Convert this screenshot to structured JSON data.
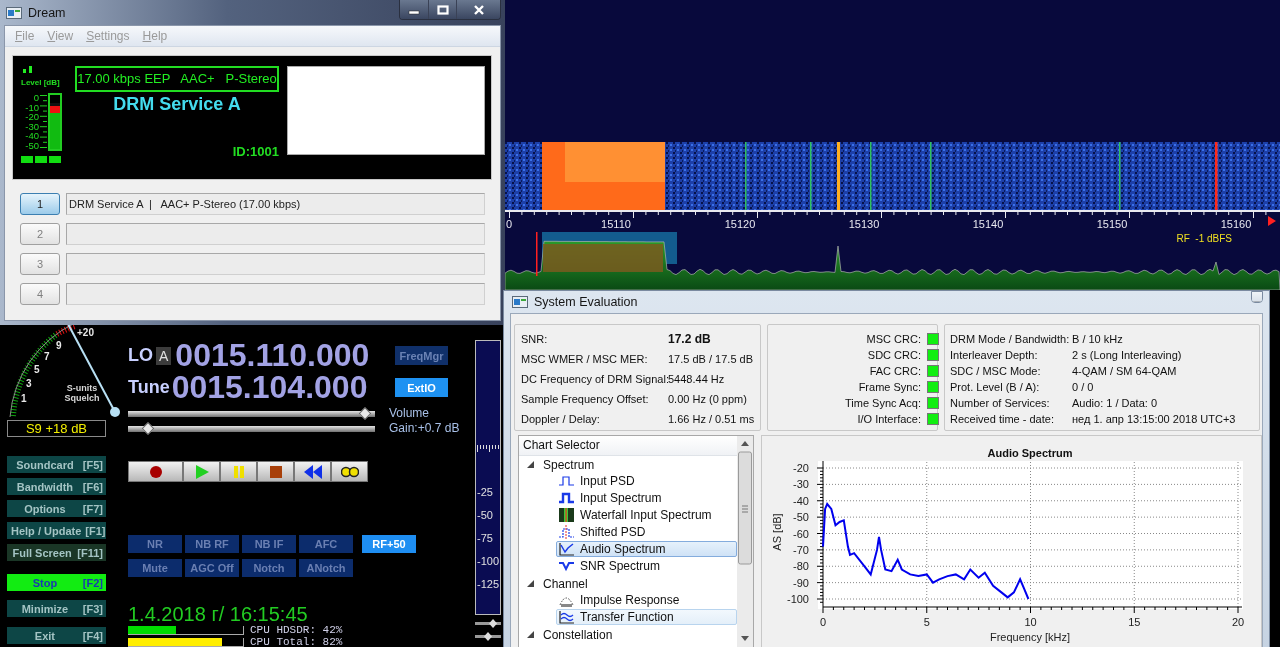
{
  "hdsdr": {
    "frequency_scale": [
      "0",
      "15110",
      "15120",
      "15130",
      "15140",
      "15150",
      "15160"
    ],
    "rf_level": "RF  -1 dBFS",
    "s_meter": {
      "top_mark": "+20",
      "scale": [
        "9",
        "7",
        "5",
        "3",
        "1"
      ],
      "units_label": "S-units",
      "squelch_label": "Squelch",
      "reading": "S9 +18 dB"
    },
    "lo": {
      "label": "LO",
      "vfo": "A",
      "frequency": "0015.110.000"
    },
    "tune": {
      "label": "Tune",
      "frequency": "0015.104.000"
    },
    "side_buttons": [
      {
        "label": "FreqMgr",
        "active": false
      },
      {
        "label": "ExtIO",
        "active": true
      }
    ],
    "sliders": [
      {
        "level": 0.96
      },
      {
        "level": 0.08
      }
    ],
    "volume_label": "Volume",
    "gain": "Gain:+0.7 dB",
    "transport": [
      {
        "kind": "record"
      },
      {
        "kind": "play"
      },
      {
        "kind": "pause"
      },
      {
        "kind": "stop"
      },
      {
        "kind": "rewind"
      },
      {
        "kind": "loop"
      }
    ],
    "function_buttons": [
      {
        "label": "Soundcard",
        "key": "[F5]",
        "active": false
      },
      {
        "label": "Bandwidth",
        "key": "[F6]",
        "active": false
      },
      {
        "label": "Options",
        "key": "[F7]",
        "active": false
      },
      {
        "label": "Help / Update",
        "key": "[F1]",
        "active": false
      },
      {
        "label": "Full Screen",
        "key": "[F11]",
        "active": false
      },
      {
        "label": "Stop",
        "key": "[F2]",
        "active": true
      },
      {
        "label": "Minimize",
        "key": "[F3]",
        "active": false
      },
      {
        "label": "Exit",
        "key": "[F4]",
        "active": false
      }
    ],
    "dsp_rows": [
      {
        "buttons": [
          {
            "label": "NR",
            "on": false
          },
          {
            "label": "NB RF",
            "on": false
          },
          {
            "label": "NB IF",
            "on": false
          },
          {
            "label": "AFC",
            "on": false
          },
          {
            "label": "RF+50",
            "on": true
          }
        ]
      },
      {
        "buttons": [
          {
            "label": "Mute",
            "on": false
          },
          {
            "label": "AGC Off",
            "on": false
          },
          {
            "label": "Notch",
            "on": false
          },
          {
            "label": "ANotch",
            "on": false
          }
        ]
      }
    ],
    "datetime": "1.4.2018 г/ 16:15:45",
    "cpu": [
      {
        "label": "CPU HDSDR: 42%",
        "level": 0.42,
        "color": "#00dd00"
      },
      {
        "label": "CPU Total: 82%",
        "level": 0.82,
        "color": "#ffee00"
      }
    ],
    "level_scale": [
      "-25",
      "-50",
      "-75",
      "-100",
      "-125"
    ],
    "mini_sliders": [
      {
        "level": 0.78
      },
      {
        "level": 0.5
      }
    ]
  },
  "dream": {
    "title": "Dream",
    "menu": [
      "File",
      "View",
      "Settings",
      "Help"
    ],
    "level_label": "Level [dB]",
    "level_scale": [
      "0",
      "-10",
      "-20",
      "-30",
      "-40",
      "-50"
    ],
    "level": 0.85,
    "bitrate": "17.00 kbps EEP   AAC+   P-Stereo",
    "service_label": "DRM Service A",
    "id": "ID:1001",
    "services": [
      {
        "number": "1",
        "selected": true,
        "text": "DRM Service A  |   AAC+ P-Stereo (17.00 kbps)"
      },
      {
        "number": "2",
        "selected": false
      },
      {
        "number": "3",
        "selected": false
      },
      {
        "number": "4",
        "selected": false
      }
    ]
  },
  "system_evaluation": {
    "title": "System Evaluation",
    "measurements": [
      {
        "label": "SNR:",
        "value": "17.2 dB"
      },
      {
        "label": "MSC WMER / MSC MER:",
        "value": "17.5 dB / 17.5 dB"
      },
      {
        "label": "DC Frequency of DRM Signal:",
        "value": "5448.44 Hz"
      },
      {
        "label": "Sample Frequency Offset:",
        "value": "0.00 Hz (0 ppm)"
      },
      {
        "label": "Doppler / Delay:",
        "value": "1.66 Hz / 0.51 ms"
      }
    ],
    "indicators": [
      {
        "label": "MSC CRC:",
        "on": true
      },
      {
        "label": "SDC CRC:",
        "on": true
      },
      {
        "label": "FAC CRC:",
        "on": true
      },
      {
        "label": "Frame Sync:",
        "on": true
      },
      {
        "label": "Time Sync Acq:",
        "on": true
      },
      {
        "label": "I/O Interface:",
        "on": true
      }
    ],
    "info": [
      {
        "label": "DRM Mode / Bandwidth:",
        "value": "B / 10 kHz"
      },
      {
        "label": "Interleaver Depth:",
        "value": "2 s (Long Interleaving)"
      },
      {
        "label": "SDC / MSC Mode:",
        "value": "4-QAM / SM 64-QAM"
      },
      {
        "label": "Prot. Level (B / A):",
        "value": "0 / 0"
      },
      {
        "label": "Number of Services:",
        "value": "Audio: 1 / Data: 0"
      },
      {
        "label": "Received time - date:",
        "value": "нед 1. апр 13:15:00 2018 UTC+3"
      }
    ],
    "chart_selector": {
      "header": "Chart Selector",
      "groups": [
        {
          "label": "Spectrum",
          "expanded": true,
          "children": [
            {
              "label": "Input PSD",
              "kind": "psd",
              "selected": false,
              "hovered": false
            },
            {
              "label": "Input Spectrum",
              "kind": "spectrum",
              "selected": false,
              "hovered": false
            },
            {
              "label": "Waterfall Input Spectrum",
              "kind": "waterfall",
              "selected": false,
              "hovered": false
            },
            {
              "label": "Shifted PSD",
              "kind": "shifted",
              "selected": false,
              "hovered": false
            },
            {
              "label": "Audio Spectrum",
              "kind": "audio",
              "selected": true,
              "hovered": false
            },
            {
              "label": "SNR Spectrum",
              "kind": "snr",
              "selected": false,
              "hovered": false
            }
          ]
        },
        {
          "label": "Channel",
          "expanded": true,
          "children": [
            {
              "label": "Impulse Response",
              "kind": "impulse",
              "selected": false,
              "hovered": false
            },
            {
              "label": "Transfer Function",
              "kind": "transfer",
              "selected": false,
              "hovered": true
            }
          ]
        },
        {
          "label": "Constellation",
          "expanded": true
        }
      ]
    },
    "chart_data": {
      "type": "line",
      "title": "Audio Spectrum",
      "xlabel": "Frequency [kHz]",
      "ylabel": "AS [dB]",
      "xlim": [
        0,
        20
      ],
      "ylim": [
        -100,
        -20
      ],
      "grid": true,
      "xticks": [
        0,
        5,
        10,
        15,
        20
      ],
      "yticks": [
        -20,
        -30,
        -40,
        -50,
        -60,
        -70,
        -80,
        -90,
        -100
      ],
      "x": [
        0,
        0.1,
        0.2,
        0.4,
        0.6,
        0.8,
        1.0,
        1.2,
        1.3,
        1.5,
        2.0,
        2.3,
        2.6,
        2.7,
        2.8,
        3.0,
        3.3,
        3.6,
        3.8,
        4.2,
        4.6,
        5.0,
        5.3,
        5.6,
        6.0,
        6.4,
        6.8,
        7.1,
        7.5,
        7.8,
        8.2,
        8.6,
        8.9,
        9.2,
        9.5,
        9.7,
        9.9
      ],
      "series": [
        {
          "color": "#0000ee",
          "values": [
            -68,
            -45,
            -42,
            -45,
            -55,
            -53,
            -52,
            -68,
            -73,
            -72,
            -80,
            -85,
            -70,
            -62,
            -70,
            -82,
            -83,
            -76,
            -82,
            -85,
            -86,
            -85,
            -90,
            -88,
            -86,
            -85,
            -88,
            -82,
            -87,
            -84,
            -92,
            -96,
            -99,
            -96,
            -88,
            -94,
            -100
          ]
        }
      ]
    }
  }
}
